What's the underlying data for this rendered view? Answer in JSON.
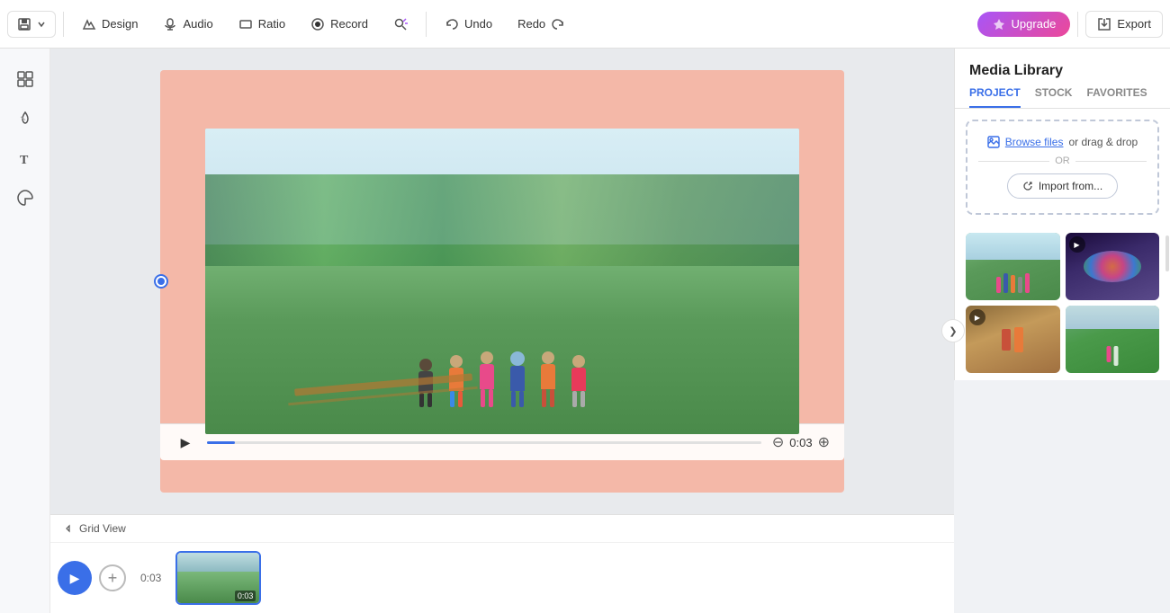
{
  "toolbar": {
    "save_label": "Save",
    "design_label": "Design",
    "audio_label": "Audio",
    "ratio_label": "Ratio",
    "record_label": "Record",
    "search_label": "Search",
    "undo_label": "Undo",
    "redo_label": "Redo",
    "upgrade_label": "Upgrade",
    "export_label": "Export"
  },
  "left_sidebar": {
    "tools": [
      {
        "name": "layout-tool",
        "icon": "⊞"
      },
      {
        "name": "effects-tool",
        "icon": "◎"
      },
      {
        "name": "text-tool",
        "icon": "T"
      },
      {
        "name": "sticker-tool",
        "icon": "✿"
      }
    ]
  },
  "canvas": {
    "background_color": "#f4b8a8",
    "video_time": "0:03"
  },
  "video_controls": {
    "play_label": "▶",
    "time": "0:03"
  },
  "timeline": {
    "grid_view_label": "Grid View",
    "time_display": "0:03",
    "add_clip_label": "+",
    "clip_duration": "0:03"
  },
  "media_library": {
    "title": "Media Library",
    "tabs": [
      {
        "id": "project",
        "label": "PROJECT"
      },
      {
        "id": "stock",
        "label": "STOCK"
      },
      {
        "id": "favorites",
        "label": "FAVORITES"
      }
    ],
    "upload": {
      "browse_text": "Browse files",
      "drag_text": " or drag & drop",
      "or_text": "OR",
      "import_label": "Import from..."
    },
    "chevron_label": "❯",
    "media_items": [
      {
        "id": "media-1",
        "has_play": false,
        "bg": "linear-gradient(160deg,#6aaa7a 0%,#4a8a5a 40%,#5a9a4a 100%)"
      },
      {
        "id": "media-2",
        "has_play": true,
        "bg": "linear-gradient(160deg,#2a1a4a 0%,#4a3a7a 30%,#7a5a9a 60%,#3a6ae0 100%)"
      },
      {
        "id": "media-3",
        "has_play": true,
        "bg": "linear-gradient(160deg,#8a6a3a 0%,#c49a5a 40%,#a07040 100%)"
      },
      {
        "id": "media-4",
        "has_play": true,
        "bg": "linear-gradient(160deg,#6aaa7a 0%,#4a9a4a 40%,#3a8a3a 100%)"
      }
    ]
  }
}
